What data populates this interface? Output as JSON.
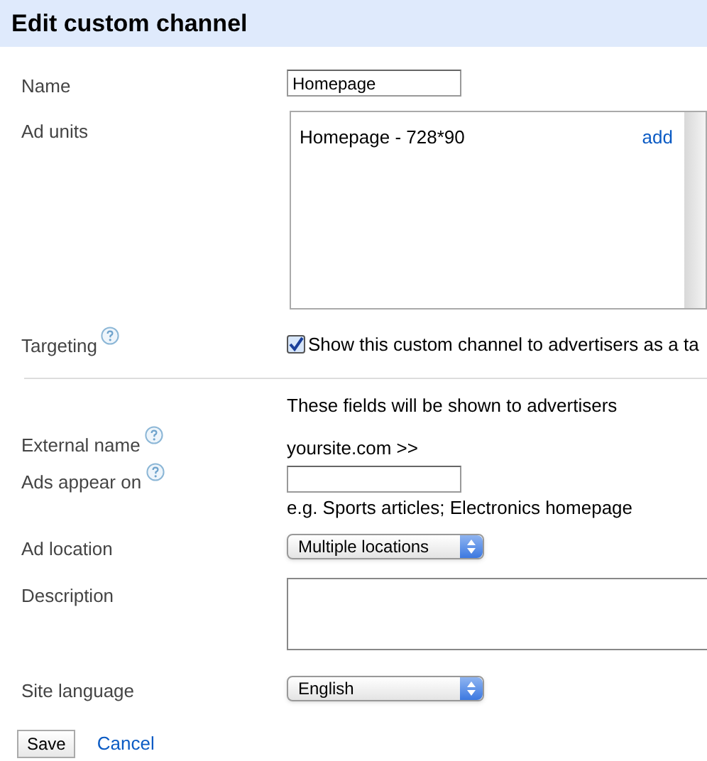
{
  "title": "Edit custom channel",
  "fields": [
    {
      "kind": "text",
      "label": "Name",
      "value": "Homepage"
    },
    {
      "kind": "list",
      "label": "Ad units",
      "items": [
        {
          "text": "Homepage - 728*90",
          "action": "add"
        }
      ]
    },
    {
      "kind": "checkbox",
      "label": "Targeting",
      "help": true,
      "checked": true,
      "text": "Show this custom channel to advertisers as a ta"
    },
    {
      "kind": "divider"
    },
    {
      "kind": "note",
      "text": "These fields will be shown to advertisers"
    },
    {
      "kind": "static",
      "label": "External name",
      "help": true,
      "value": "yoursite.com >>"
    },
    {
      "kind": "text",
      "label": "Ads appear on",
      "help": true,
      "hint": "e.g. Sports articles; Electronics homepage"
    },
    {
      "kind": "select",
      "label": "Ad location",
      "value": "Multiple locations"
    },
    {
      "kind": "textarea",
      "label": "Description"
    },
    {
      "kind": "select",
      "label": "Site language",
      "value": "English"
    }
  ],
  "buttons": [
    {
      "kind": "button",
      "label": "Save"
    },
    {
      "kind": "link",
      "label": "Cancel"
    }
  ]
}
